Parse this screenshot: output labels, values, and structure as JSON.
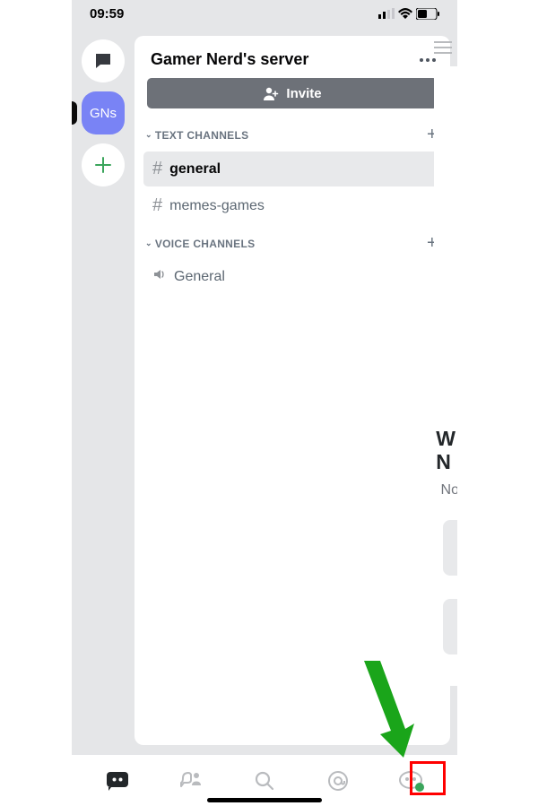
{
  "status": {
    "time": "09:59"
  },
  "server": {
    "rail_label": "GNs",
    "title": "Gamer Nerd's server",
    "invite_label": "Invite"
  },
  "sections": {
    "text_label": "TEXT CHANNELS",
    "voice_label": "VOICE CHANNELS"
  },
  "text_channels": [
    {
      "name": "general",
      "active": true
    },
    {
      "name": "memes-games",
      "active": false
    }
  ],
  "voice_channels": [
    {
      "name": "General"
    }
  ],
  "peek": {
    "line1": "W",
    "line2": "N",
    "sub": "No"
  }
}
